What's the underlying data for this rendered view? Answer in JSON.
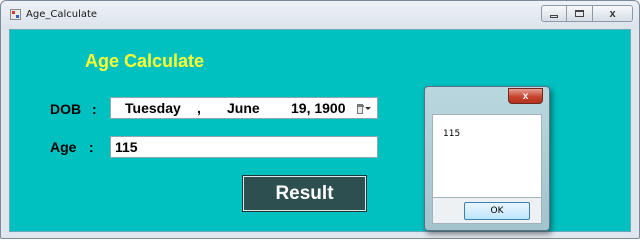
{
  "window": {
    "title": "Age_Calculate",
    "icon": "app-form-icon",
    "controls": {
      "minimize_icon": "minimize-icon",
      "maximize_icon": "maximize-icon",
      "close_glyph": "x"
    }
  },
  "form": {
    "heading": "Age Calculate",
    "dob_label": "DOB",
    "age_label": "Age",
    "colon": ":",
    "dob": {
      "day": "Tuesday",
      "separator": ",",
      "month": "June",
      "date": "19, 1900",
      "dropdown_icon": "calendar-dropdown-icon"
    },
    "age_value": "115",
    "result_button": "Result"
  },
  "message_box": {
    "close_glyph": "x",
    "message": "115",
    "ok_label": "OK"
  },
  "colors": {
    "form_background": "#00c0c0",
    "heading": "#ffff33",
    "result_button": "#2d4f4f"
  }
}
